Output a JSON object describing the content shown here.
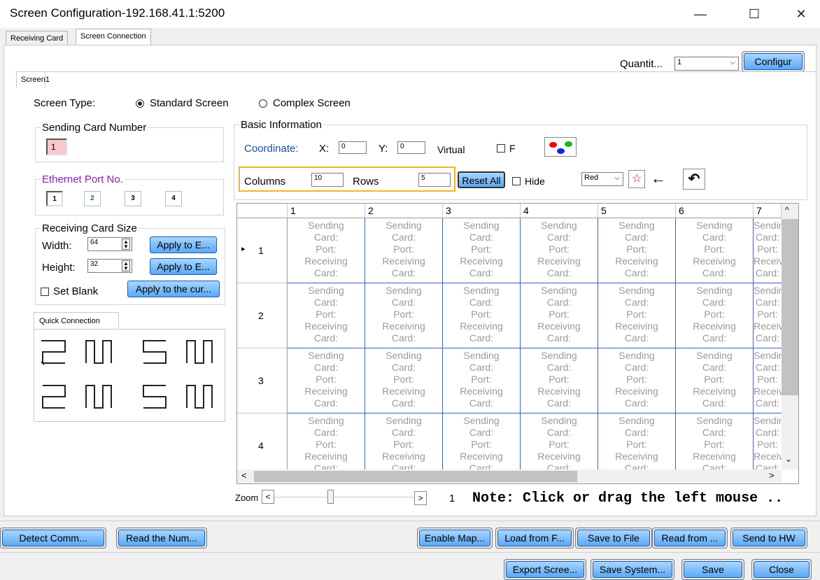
{
  "window": {
    "title": "Screen Configuration-192.168.41.1:5200",
    "min": "—",
    "max": "☐",
    "close": "✕"
  },
  "tabs": [
    "Receiving Card",
    "Screen Connection"
  ],
  "screen_tab": "Screen1",
  "quantity": {
    "label": "Quantit...",
    "value": "1",
    "configure": "Configur"
  },
  "screen_type": {
    "label": "Screen Type:",
    "standard": "Standard Screen",
    "complex": "Complex Screen"
  },
  "sending_card": {
    "label": "Sending Card Number",
    "value": "1"
  },
  "ethernet": {
    "label": "Ethernet Port No.",
    "ports": [
      "1",
      "2",
      "3",
      "4"
    ],
    "colors": [
      "#1a1aa0",
      "#8a1fb0",
      "#000000",
      "#1a7a1a"
    ]
  },
  "receiving_size": {
    "label": "Receiving Card Size",
    "width_label": "Width:",
    "width": "64",
    "height_label": "Height:",
    "height": "32",
    "apply_each": "Apply to E...",
    "set_blank": "Set Blank",
    "apply_current": "Apply to the cur..."
  },
  "quick_connection": {
    "label": "Quick Connection"
  },
  "basic": {
    "label": "Basic Information",
    "coordinate": "Coordinate:",
    "x_label": "X:",
    "x": "0",
    "y_label": "Y:",
    "y": "0",
    "virtual": "Virtual",
    "f_label": "F",
    "columns_label": "Columns",
    "columns": "10",
    "rows_label": "Rows",
    "rows": "5",
    "reset_all": "Reset All",
    "hide": "Hide",
    "color": "Red"
  },
  "grid": {
    "columns": [
      "1",
      "2",
      "3",
      "4",
      "5",
      "6",
      "7"
    ],
    "rows": [
      "1",
      "2",
      "3",
      "4"
    ],
    "cell_lines": [
      "Sending",
      "Card:",
      "Port:",
      "Receiving",
      "Card:"
    ]
  },
  "zoom": {
    "label": "Zoom",
    "left": "<",
    "right": ">",
    "value": "1",
    "note": "Note: Click or drag the left mouse .."
  },
  "bottom1": {
    "detect": "Detect Comm...",
    "read_num": "Read the Num...",
    "enable_map": "Enable Map...",
    "load_file": "Load from F...",
    "save_file": "Save to File",
    "read_from": "Read from ...",
    "send_hw": "Send to HW"
  },
  "bottom2": {
    "export": "Export Scree...",
    "save_system": "Save System...",
    "save": "Save",
    "close": "Close"
  }
}
